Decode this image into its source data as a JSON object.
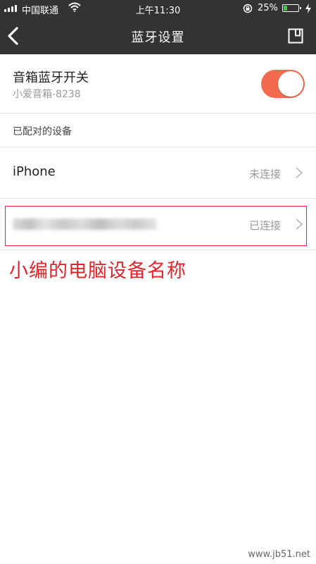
{
  "status_bar": {
    "carrier": "中国联通",
    "time": "上午11:30",
    "battery_percent": "25%",
    "battery_level": 0.25,
    "icons": [
      "signal-icon",
      "wifi-icon",
      "rotation-lock-icon",
      "battery-icon",
      "charging-bolt-icon"
    ]
  },
  "nav": {
    "back_icon": "chevron-left-icon",
    "title": "蓝牙设置",
    "save_icon": "save-icon"
  },
  "speaker_bluetooth": {
    "title": "音箱蓝牙开关",
    "subtitle": "小爱音箱-8238",
    "enabled": true,
    "accent_color": "#f26b4f"
  },
  "paired_section": {
    "label": "已配对的设备"
  },
  "devices": [
    {
      "name": "iPhone",
      "status": "未连接"
    },
    {
      "name": "",
      "status": "已连接",
      "name_obscured": true
    }
  ],
  "annotation": {
    "text": "小编的电脑设备名称",
    "color": "#e3242b"
  },
  "watermark": {
    "text": "www.jb51.net"
  }
}
